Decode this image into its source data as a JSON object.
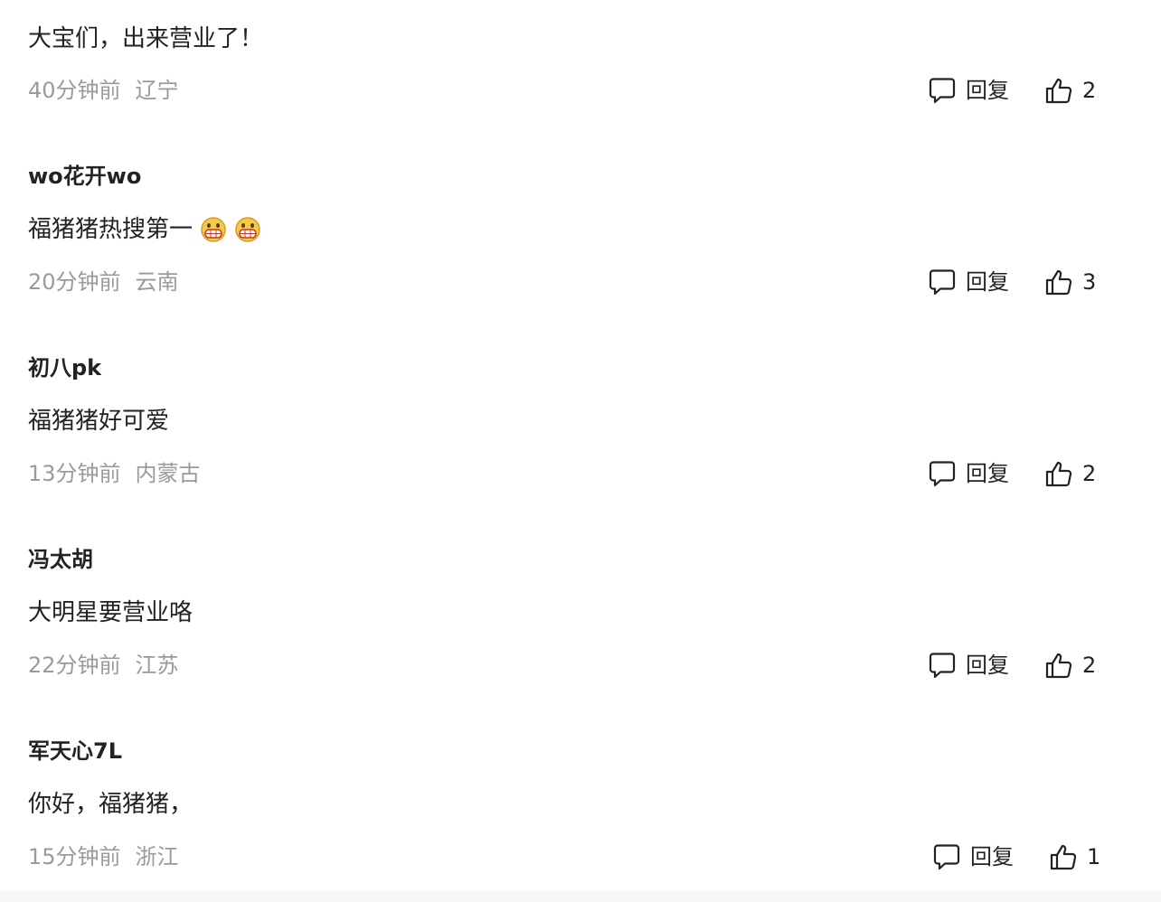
{
  "comments": [
    {
      "username": "",
      "text": "大宝们，出来营业了！",
      "emoji_count": 0,
      "time": "40分钟前",
      "location": "辽宁",
      "reply_label": "回复",
      "likes": "2"
    },
    {
      "username": "wo花开wo",
      "text": "福猪猪热搜第一",
      "emoji_count": 2,
      "emoji": "grinning-face-icon",
      "time": "20分钟前",
      "location": "云南",
      "reply_label": "回复",
      "likes": "3"
    },
    {
      "username": "初八pk",
      "text": "福猪猪好可爱",
      "emoji_count": 0,
      "time": "13分钟前",
      "location": "内蒙古",
      "reply_label": "回复",
      "likes": "2"
    },
    {
      "username": "冯太胡",
      "text": "大明星要营业咯",
      "emoji_count": 0,
      "time": "22分钟前",
      "location": "江苏",
      "reply_label": "回复",
      "likes": "2"
    },
    {
      "username": "军天心7L",
      "text": "你好，福猪猪，",
      "emoji_count": 0,
      "time": "15分钟前",
      "location": "浙江",
      "reply_label": "回复",
      "likes": "1"
    }
  ],
  "colors": {
    "text": "#222222",
    "meta": "#9a9a9a",
    "background": "#ffffff",
    "footer": "#f7f7f7"
  },
  "icons": {
    "reply": "comment-bubble-icon",
    "like": "thumbs-up-icon"
  }
}
